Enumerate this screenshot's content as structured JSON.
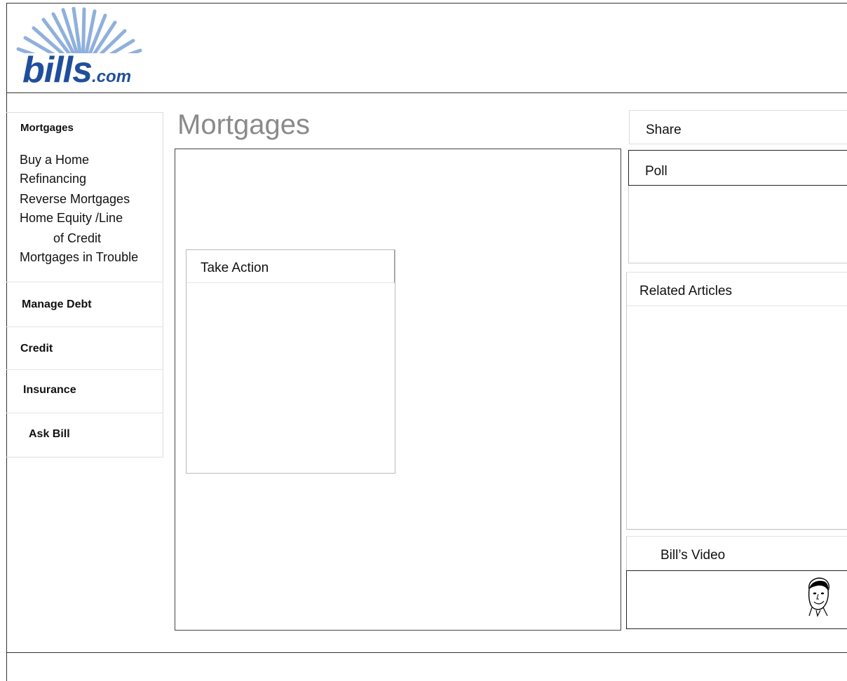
{
  "logo": {
    "brand": "bills",
    "suffix": ".com",
    "brand_color": "#1f4f9c",
    "ray_color": "#8fb0dc"
  },
  "sidebar": {
    "heading": "Mortgages",
    "subitems": [
      "Buy a Home",
      "Refinancing",
      "Reverse Mortgages",
      "Home Equity /Line",
      "of Credit",
      "Mortgages in Trouble"
    ],
    "sections": [
      "Manage Debt",
      "Credit",
      "Insurance",
      "Ask Bill"
    ]
  },
  "main": {
    "page_title": "Mortgages",
    "page_title_color": "#8a8a8a",
    "take_action_title": "Take Action"
  },
  "right": {
    "share_title": "Share",
    "poll_title": "Poll",
    "related_title": "Related Articles",
    "video_title": "Bill’s Video",
    "video_icon": "bill-face-icon"
  }
}
